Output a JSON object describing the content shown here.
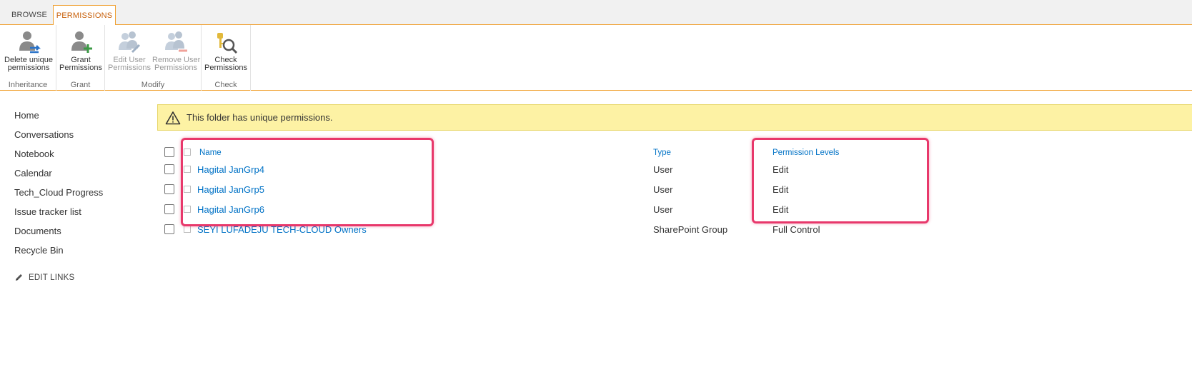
{
  "tabs": [
    {
      "label": "BROWSE",
      "active": false
    },
    {
      "label": "PERMISSIONS",
      "active": true
    }
  ],
  "ribbon": {
    "groups": [
      {
        "label": "Inheritance",
        "buttons": [
          {
            "label1": "Delete unique",
            "label2": "permissions",
            "icon": "delete-unique-permissions-icon",
            "enabled": true
          }
        ]
      },
      {
        "label": "Grant",
        "buttons": [
          {
            "label1": "Grant",
            "label2": "Permissions",
            "icon": "grant-permissions-icon",
            "enabled": true
          }
        ]
      },
      {
        "label": "Modify",
        "buttons": [
          {
            "label1": "Edit User",
            "label2": "Permissions",
            "icon": "edit-user-permissions-icon",
            "enabled": false
          },
          {
            "label1": "Remove User",
            "label2": "Permissions",
            "icon": "remove-user-permissions-icon",
            "enabled": false
          }
        ]
      },
      {
        "label": "Check",
        "buttons": [
          {
            "label1": "Check",
            "label2": "Permissions",
            "icon": "check-permissions-icon",
            "enabled": true
          }
        ]
      }
    ]
  },
  "leftnav": {
    "items": [
      "Home",
      "Conversations",
      "Notebook",
      "Calendar",
      "Tech_Cloud Progress",
      "Issue tracker list",
      "Documents",
      "Recycle Bin"
    ],
    "edit_links": "EDIT LINKS"
  },
  "banner": {
    "message": "This folder has unique permissions.",
    "icon": "warning-icon"
  },
  "table": {
    "headers": {
      "name": "Name",
      "type": "Type",
      "permission": "Permission Levels"
    },
    "rows": [
      {
        "name": "Hagital JanGrp4",
        "type": "User",
        "permission": "Edit"
      },
      {
        "name": "Hagital JanGrp5",
        "type": "User",
        "permission": "Edit"
      },
      {
        "name": "Hagital JanGrp6",
        "type": "User",
        "permission": "Edit"
      },
      {
        "name": "SEYI LUFADEJU TECH-CLOUD Owners",
        "type": "SharePoint Group",
        "permission": "Full Control"
      }
    ]
  },
  "colors": {
    "accent": "#f0a030",
    "link": "#0072c6",
    "highlight": "#e8386b",
    "banner": "#fdf2a4"
  }
}
